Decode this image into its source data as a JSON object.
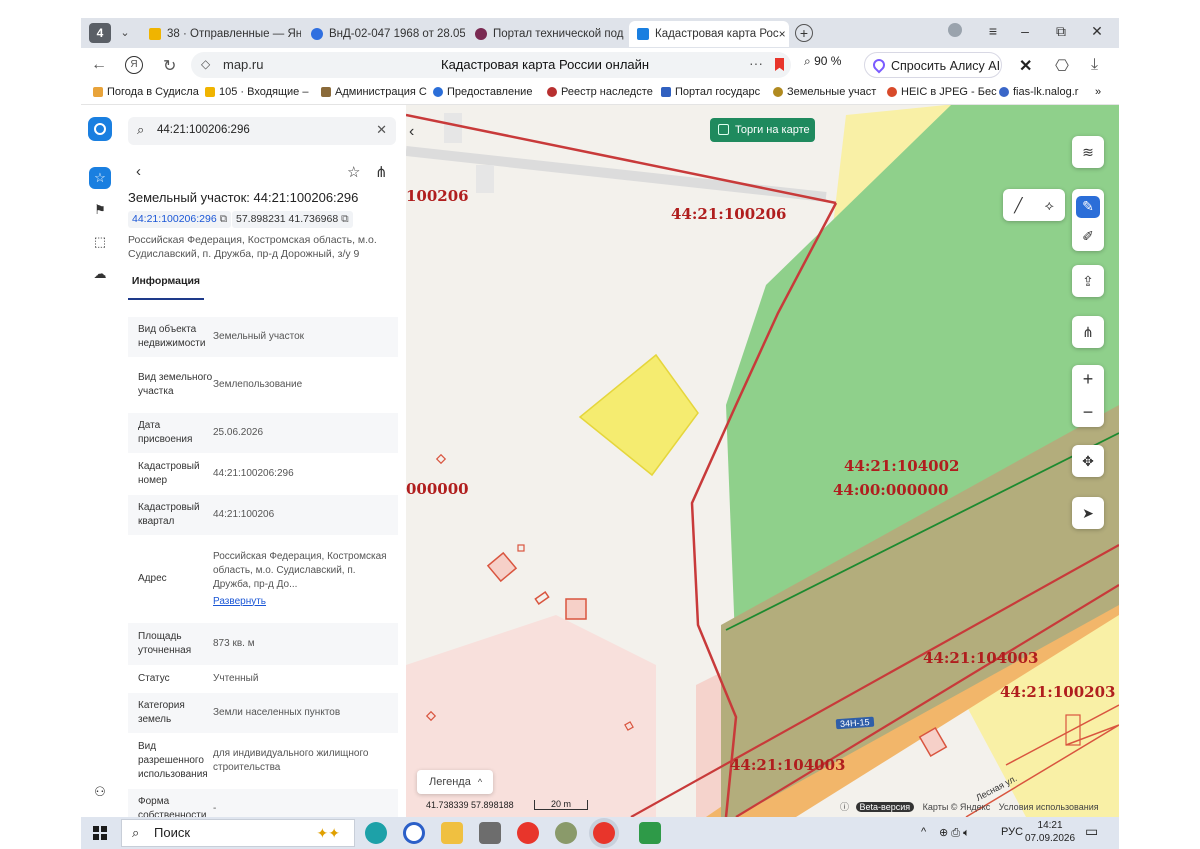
{
  "browser": {
    "tab_count": "4",
    "tabs": [
      {
        "label": "38 · Отправленные — Янд",
        "color": "#f0b400"
      },
      {
        "label": "ВнД-02-047 1968 от 28.05",
        "color": "#2f6fe0"
      },
      {
        "label": "Портал технической под",
        "color": "#7a2a52"
      },
      {
        "label": "Кадастровая карта Рос",
        "color": "#1a7fe0",
        "active": true
      }
    ],
    "tab_close": "×",
    "new_tab": "+",
    "url": "map.ru",
    "page_title": "Кадастровая карта России онлайн",
    "zoom": "90 %",
    "alice_label": "Спросить Алису AI",
    "bookmarks": [
      {
        "label": "Погода в Судисла",
        "color": "#e8a33a"
      },
      {
        "label": "105 · Входящие –",
        "color": "#f0b400"
      },
      {
        "label": "Администрация С",
        "color": "#8a6a3a"
      },
      {
        "label": "Предоставление",
        "color": "#2b6ed8"
      },
      {
        "label": "Реестр наследстe",
        "color": "#b83030"
      },
      {
        "label": "Портал государс",
        "color": "#3060c0"
      },
      {
        "label": "Земельные участ",
        "color": "#b08a20"
      },
      {
        "label": "HEIC в JPEG - Бес",
        "color": "#d84a2a"
      },
      {
        "label": "fias-lk.nalog.r",
        "color": "#3a66c8"
      }
    ],
    "bookmarks_more": "»"
  },
  "panel": {
    "search_query": "44:21:100206:296",
    "object_title": "Земельный участок: 44:21:100206:296",
    "cad_chip": "44:21:100206:296",
    "coord_chip": "57.898231 41.736968",
    "address_short": "Российская Федерация, Костромская область, м.о. Судиславский, п. Дружба, пр-д Дорожный, з/у 9",
    "tab_info": "Информация",
    "rows": [
      {
        "key": "Вид объекта недвижимости",
        "value": "Земельный участок"
      },
      {
        "key": "Вид земельного участка",
        "value": "Землепользование"
      },
      {
        "key": "Дата присвоения",
        "value": "25.06.2026"
      },
      {
        "key": "Кадастровый номер",
        "value": "44:21:100206:296"
      },
      {
        "key": "Кадастровый квартал",
        "value": "44:21:100206"
      },
      {
        "key": "Адрес",
        "value": "Российская Федерация, Костромская область, м.о. Судиславский, п. Дружба, пр-д До...",
        "link": "Развернуть"
      },
      {
        "key": "Площадь уточненная",
        "value": "873 кв. м"
      },
      {
        "key": "Статус",
        "value": "Учтенный"
      },
      {
        "key": "Категория земель",
        "value": "Земли населенных пунктов"
      },
      {
        "key": "Вид разрешенного использования",
        "value": "для индивидуального жилищного строительства"
      },
      {
        "key": "Форма собственности",
        "value": "-"
      }
    ]
  },
  "map": {
    "torgi_label": "Торги на карте",
    "labels": {
      "top_left": "100206",
      "top_center": "44:21:100206",
      "mid_left": "000000",
      "green_a": "44:21:104002",
      "green_b": "44:00:000000",
      "right_a": "44:21:104003",
      "right_b": "44:21:100203",
      "bottom": "44:21:104003"
    },
    "road_label": "34Н-15",
    "street_label": "Лесная ул.",
    "legend_label": "Легенда",
    "coords": "41.738339  57.898188",
    "scale": "20 m",
    "beta": "Beta-версия",
    "attribution": "Карты © Яндекс",
    "terms": "Условия использования"
  },
  "taskbar": {
    "search_label": "Поиск",
    "lang": "РУС",
    "time": "14:21",
    "date": "07.09.2026"
  }
}
